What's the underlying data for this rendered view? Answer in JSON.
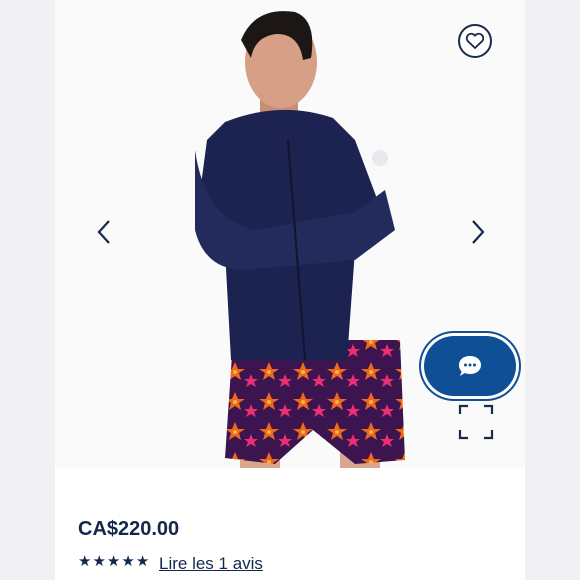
{
  "product": {
    "price": "CA$220.00",
    "rating": 5,
    "rating_max": 5,
    "reviews_link": "Lire les 1 avis"
  },
  "icons": {
    "wishlist": "heart-outline-icon",
    "prev": "chevron-left-icon",
    "next": "chevron-right-icon",
    "chat": "chat-bubble-icon",
    "fullscreen": "fullscreen-icon",
    "star": "star-icon"
  },
  "colors": {
    "brand_navy": "#12284a",
    "chat_blue": "#0f4f95",
    "background": "#f3f3f5"
  }
}
